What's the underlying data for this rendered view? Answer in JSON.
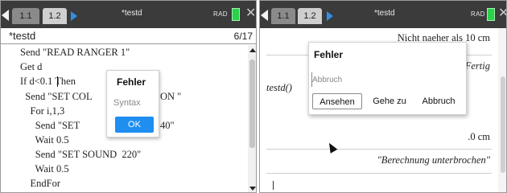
{
  "left": {
    "tabs": [
      "1.1",
      "1.2"
    ],
    "doc_title": "*testd",
    "mode": "RAD",
    "editor": {
      "program_name": "*testd",
      "line_count": "6/17",
      "lines": [
        "Send \"READ RANGER 1\"",
        "Get d",
        "If d<0.1 Then",
        "  Send \"SET COL",
        "    For i,1,3",
        "      Send \"SET",
        "      Wait 0.5",
        "      Send \"SET SOUND  220\"",
        "      Wait 0.5",
        "    EndFor"
      ],
      "overlap_text_1": "ON \"",
      "overlap_text_2": "40\""
    },
    "error_dialog": {
      "title": "Fehler",
      "message": "Syntax",
      "ok_label": "OK"
    }
  },
  "right": {
    "tabs": [
      "1.1",
      "1.2"
    ],
    "doc_title": "*testd",
    "mode": "RAD",
    "history": {
      "line1": "Nicht naeher als 10 cm",
      "line2": "Fertig",
      "input": "testd()",
      "partial": ".0 cm",
      "result": "\"Berechnung unterbrochen\""
    },
    "error_dialog": {
      "title": "Fehler",
      "message": "Abbruch",
      "buttons": [
        "Ansehen",
        "Gehe zu",
        "Abbruch"
      ]
    }
  },
  "colors": {
    "topbar": "#3b3b3b",
    "battery": "#29d24a",
    "accent": "#1f8ef1",
    "play": "#2f90e8"
  }
}
